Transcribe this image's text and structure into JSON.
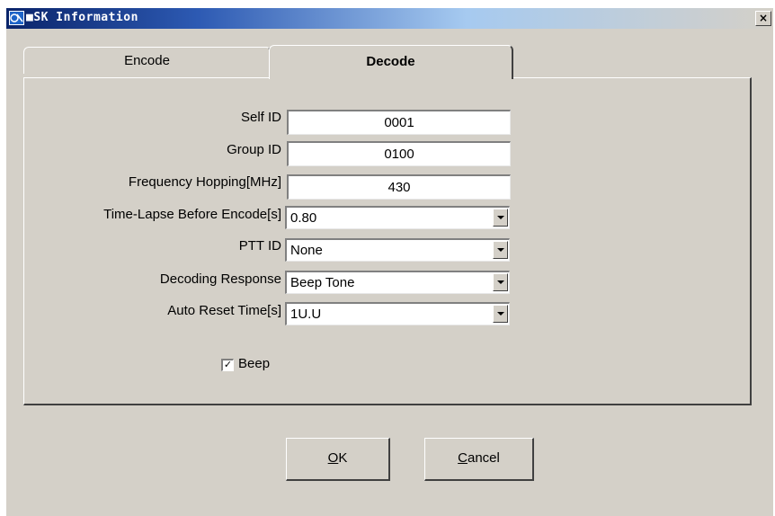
{
  "window": {
    "title": "■SK Information",
    "close_label": "×"
  },
  "tabs": [
    {
      "label": "Encode",
      "active": false
    },
    {
      "label": "Decode",
      "active": true
    }
  ],
  "fields": {
    "self_id": {
      "label": "Self ID",
      "value": "0001"
    },
    "group_id": {
      "label": "Group ID",
      "value": "0100"
    },
    "frequency_hopping": {
      "label": "Frequency Hopping[MHz]",
      "value": "430"
    },
    "time_lapse": {
      "label": "Time-Lapse Before Encode[s]",
      "value": "0.80"
    },
    "ptt_id": {
      "label": "PTT ID",
      "value": "None"
    },
    "decoding_response": {
      "label": "Decoding Response",
      "value": "Beep Tone"
    },
    "auto_reset_time": {
      "label": "Auto Reset Time[s]",
      "value": "1U.U"
    }
  },
  "beep": {
    "label": "Beep",
    "checked": true,
    "mark": "✓"
  },
  "buttons": {
    "ok": {
      "accel": "O",
      "rest": "K"
    },
    "cancel": {
      "accel": "C",
      "rest": "ancel"
    }
  }
}
